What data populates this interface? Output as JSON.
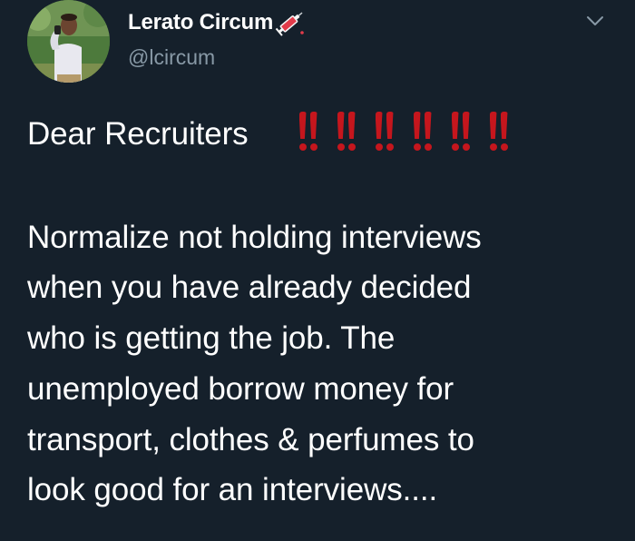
{
  "author": {
    "display_name": "Lerato Circum",
    "handle": "@lcircum",
    "name_emoji": "syringe-icon"
  },
  "header": {
    "menu_icon": "chevron-down-icon"
  },
  "tweet": {
    "heading": "Dear Recruiters",
    "heading_emoji": "double-exclamation-icon",
    "heading_emoji_count": 6,
    "body_lines": [
      "Normalize not holding interviews",
      "when you have already decided",
      "who is getting the job. The",
      "unemployed borrow money for",
      "transport, clothes & perfumes to",
      "look good for an interviews...."
    ]
  },
  "colors": {
    "background": "#15202b",
    "text": "#ffffff",
    "secondary_text": "#8899a6",
    "emoji_red": "#c5161d"
  }
}
